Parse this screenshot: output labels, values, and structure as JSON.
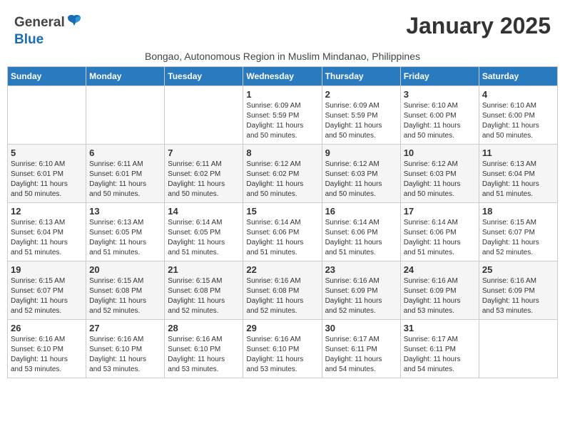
{
  "header": {
    "logo_general": "General",
    "logo_blue": "Blue",
    "month_title": "January 2025",
    "subtitle": "Bongao, Autonomous Region in Muslim Mindanao, Philippines"
  },
  "days_of_week": [
    "Sunday",
    "Monday",
    "Tuesday",
    "Wednesday",
    "Thursday",
    "Friday",
    "Saturday"
  ],
  "weeks": [
    [
      {
        "day": "",
        "info": ""
      },
      {
        "day": "",
        "info": ""
      },
      {
        "day": "",
        "info": ""
      },
      {
        "day": "1",
        "info": "Sunrise: 6:09 AM\nSunset: 5:59 PM\nDaylight: 11 hours\nand 50 minutes."
      },
      {
        "day": "2",
        "info": "Sunrise: 6:09 AM\nSunset: 5:59 PM\nDaylight: 11 hours\nand 50 minutes."
      },
      {
        "day": "3",
        "info": "Sunrise: 6:10 AM\nSunset: 6:00 PM\nDaylight: 11 hours\nand 50 minutes."
      },
      {
        "day": "4",
        "info": "Sunrise: 6:10 AM\nSunset: 6:00 PM\nDaylight: 11 hours\nand 50 minutes."
      }
    ],
    [
      {
        "day": "5",
        "info": "Sunrise: 6:10 AM\nSunset: 6:01 PM\nDaylight: 11 hours\nand 50 minutes."
      },
      {
        "day": "6",
        "info": "Sunrise: 6:11 AM\nSunset: 6:01 PM\nDaylight: 11 hours\nand 50 minutes."
      },
      {
        "day": "7",
        "info": "Sunrise: 6:11 AM\nSunset: 6:02 PM\nDaylight: 11 hours\nand 50 minutes."
      },
      {
        "day": "8",
        "info": "Sunrise: 6:12 AM\nSunset: 6:02 PM\nDaylight: 11 hours\nand 50 minutes."
      },
      {
        "day": "9",
        "info": "Sunrise: 6:12 AM\nSunset: 6:03 PM\nDaylight: 11 hours\nand 50 minutes."
      },
      {
        "day": "10",
        "info": "Sunrise: 6:12 AM\nSunset: 6:03 PM\nDaylight: 11 hours\nand 50 minutes."
      },
      {
        "day": "11",
        "info": "Sunrise: 6:13 AM\nSunset: 6:04 PM\nDaylight: 11 hours\nand 51 minutes."
      }
    ],
    [
      {
        "day": "12",
        "info": "Sunrise: 6:13 AM\nSunset: 6:04 PM\nDaylight: 11 hours\nand 51 minutes."
      },
      {
        "day": "13",
        "info": "Sunrise: 6:13 AM\nSunset: 6:05 PM\nDaylight: 11 hours\nand 51 minutes."
      },
      {
        "day": "14",
        "info": "Sunrise: 6:14 AM\nSunset: 6:05 PM\nDaylight: 11 hours\nand 51 minutes."
      },
      {
        "day": "15",
        "info": "Sunrise: 6:14 AM\nSunset: 6:06 PM\nDaylight: 11 hours\nand 51 minutes."
      },
      {
        "day": "16",
        "info": "Sunrise: 6:14 AM\nSunset: 6:06 PM\nDaylight: 11 hours\nand 51 minutes."
      },
      {
        "day": "17",
        "info": "Sunrise: 6:14 AM\nSunset: 6:06 PM\nDaylight: 11 hours\nand 51 minutes."
      },
      {
        "day": "18",
        "info": "Sunrise: 6:15 AM\nSunset: 6:07 PM\nDaylight: 11 hours\nand 52 minutes."
      }
    ],
    [
      {
        "day": "19",
        "info": "Sunrise: 6:15 AM\nSunset: 6:07 PM\nDaylight: 11 hours\nand 52 minutes."
      },
      {
        "day": "20",
        "info": "Sunrise: 6:15 AM\nSunset: 6:08 PM\nDaylight: 11 hours\nand 52 minutes."
      },
      {
        "day": "21",
        "info": "Sunrise: 6:15 AM\nSunset: 6:08 PM\nDaylight: 11 hours\nand 52 minutes."
      },
      {
        "day": "22",
        "info": "Sunrise: 6:16 AM\nSunset: 6:08 PM\nDaylight: 11 hours\nand 52 minutes."
      },
      {
        "day": "23",
        "info": "Sunrise: 6:16 AM\nSunset: 6:09 PM\nDaylight: 11 hours\nand 52 minutes."
      },
      {
        "day": "24",
        "info": "Sunrise: 6:16 AM\nSunset: 6:09 PM\nDaylight: 11 hours\nand 53 minutes."
      },
      {
        "day": "25",
        "info": "Sunrise: 6:16 AM\nSunset: 6:09 PM\nDaylight: 11 hours\nand 53 minutes."
      }
    ],
    [
      {
        "day": "26",
        "info": "Sunrise: 6:16 AM\nSunset: 6:10 PM\nDaylight: 11 hours\nand 53 minutes."
      },
      {
        "day": "27",
        "info": "Sunrise: 6:16 AM\nSunset: 6:10 PM\nDaylight: 11 hours\nand 53 minutes."
      },
      {
        "day": "28",
        "info": "Sunrise: 6:16 AM\nSunset: 6:10 PM\nDaylight: 11 hours\nand 53 minutes."
      },
      {
        "day": "29",
        "info": "Sunrise: 6:16 AM\nSunset: 6:10 PM\nDaylight: 11 hours\nand 53 minutes."
      },
      {
        "day": "30",
        "info": "Sunrise: 6:17 AM\nSunset: 6:11 PM\nDaylight: 11 hours\nand 54 minutes."
      },
      {
        "day": "31",
        "info": "Sunrise: 6:17 AM\nSunset: 6:11 PM\nDaylight: 11 hours\nand 54 minutes."
      },
      {
        "day": "",
        "info": ""
      }
    ]
  ]
}
